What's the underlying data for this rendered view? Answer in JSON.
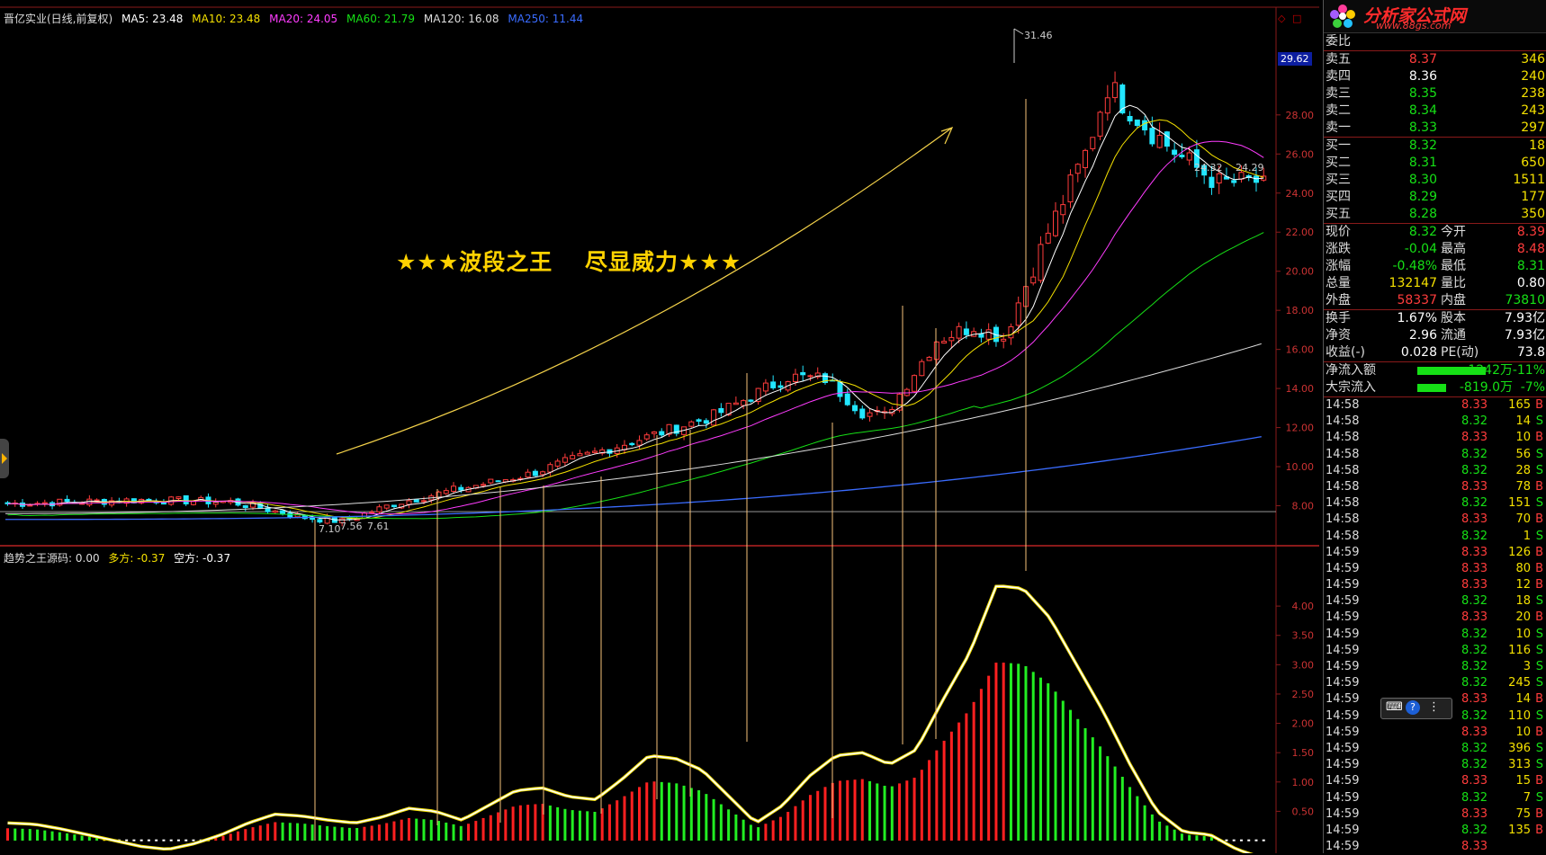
{
  "header": {
    "title": "晋亿实业(日线,前复权)",
    "ma5": "MA5: 23.48",
    "ma10": "MA10: 23.48",
    "ma20": "MA20: 24.05",
    "ma60": "MA60: 21.79",
    "ma120": "MA120: 16.08",
    "ma250": "MA250: 11.44",
    "colors": {
      "ma5": "#ffffff",
      "ma10": "#f4e000",
      "ma20": "#ff3cff",
      "ma60": "#16e016",
      "ma120": "#dddddd",
      "ma250": "#3a6cff"
    }
  },
  "main_chart": {
    "slogan": "★★★波段之王　 尽显威力★★★",
    "price_axis": [
      "28.00",
      "26.00",
      "24.00",
      "22.00",
      "20.00",
      "18.00",
      "16.00",
      "14.00",
      "12.00",
      "10.00",
      "8.00"
    ],
    "current_price_tag": "29.62",
    "high_label": "31.46",
    "low_label": "7.10",
    "label_756": "7.56",
    "label_761": "7.61",
    "label_2432": "24.32",
    "label_2429": "24.29"
  },
  "indicator": {
    "name": "趋势之王源码",
    "value": ": 0.00",
    "duofang": "多方: -0.37",
    "kongfang": "空方: -0.37",
    "axis": [
      "4.00",
      "3.50",
      "3.00",
      "2.50",
      "2.00",
      "1.50",
      "1.00",
      "0.50"
    ]
  },
  "chart_data": {
    "type": "line",
    "title": "",
    "price_ylim": [
      7,
      32
    ],
    "indicator_ylim": [
      -0.3,
      4.5
    ],
    "indicator_curve": [
      0.3,
      0.28,
      0.2,
      0.1,
      0.0,
      -0.1,
      -0.15,
      -0.05,
      0.1,
      0.3,
      0.45,
      0.42,
      0.35,
      0.3,
      0.4,
      0.55,
      0.5,
      0.35,
      0.6,
      0.85,
      0.9,
      0.75,
      0.7,
      1.05,
      1.45,
      1.4,
      1.2,
      0.75,
      0.3,
      0.6,
      1.1,
      1.45,
      1.5,
      1.3,
      1.55,
      2.4,
      3.2,
      4.35,
      4.3,
      3.8,
      3.0,
      2.2,
      1.3,
      0.5,
      0.15,
      0.1,
      -0.15,
      -0.3
    ]
  },
  "quote_panel": {
    "logo_title": "分析家公式网",
    "logo_url": "www.88gs.com",
    "weibi_label": "委比",
    "asks": [
      {
        "label": "卖五",
        "price": "8.37",
        "vol": "346"
      },
      {
        "label": "卖四",
        "price": "8.36",
        "vol": "240"
      },
      {
        "label": "卖三",
        "price": "8.35",
        "vol": "238"
      },
      {
        "label": "卖二",
        "price": "8.34",
        "vol": "243"
      },
      {
        "label": "卖一",
        "price": "8.33",
        "vol": "297"
      }
    ],
    "bids": [
      {
        "label": "买一",
        "price": "8.32",
        "vol": "18"
      },
      {
        "label": "买二",
        "price": "8.31",
        "vol": "650"
      },
      {
        "label": "买三",
        "price": "8.30",
        "vol": "1511"
      },
      {
        "label": "买四",
        "price": "8.29",
        "vol": "177"
      },
      {
        "label": "买五",
        "price": "8.28",
        "vol": "350"
      }
    ],
    "stats1": [
      {
        "l1": "现价",
        "v1": "8.32",
        "l2": "今开",
        "v2": "8.39"
      },
      {
        "l1": "涨跌",
        "v1": "-0.04",
        "l2": "最高",
        "v2": "8.48"
      },
      {
        "l1": "涨幅",
        "v1": "-0.48%",
        "l2": "最低",
        "v2": "8.31"
      },
      {
        "l1": "总量",
        "v1": "132147",
        "l2": "量比",
        "v2": "0.80"
      },
      {
        "l1": "外盘",
        "v1": "58337",
        "l2": "内盘",
        "v2": "73810"
      }
    ],
    "stats2": [
      {
        "l1": "换手",
        "v1": "1.67%",
        "l2": "股本",
        "v2": "7.93亿"
      },
      {
        "l1": "净资",
        "v1": "2.96",
        "l2": "流通",
        "v2": "7.93亿"
      },
      {
        "l1": "收益(-)",
        "v1": "0.028",
        "l2": "PE(动)",
        "v2": "73.8"
      }
    ],
    "flows": [
      {
        "label": "净流入额",
        "value": "-1242万",
        "pct": "-11%",
        "bar_fraction": 0.95
      },
      {
        "label": "大宗流入",
        "value": "-819.0万",
        "pct": "-7%",
        "bar_fraction": 0.4
      }
    ],
    "ticks": [
      {
        "t": "14:58",
        "p": "8.33",
        "v": "165",
        "d": "B"
      },
      {
        "t": "14:58",
        "p": "8.32",
        "v": "14",
        "d": "S"
      },
      {
        "t": "14:58",
        "p": "8.33",
        "v": "10",
        "d": "B"
      },
      {
        "t": "14:58",
        "p": "8.32",
        "v": "56",
        "d": "S"
      },
      {
        "t": "14:58",
        "p": "8.32",
        "v": "28",
        "d": "S"
      },
      {
        "t": "14:58",
        "p": "8.33",
        "v": "78",
        "d": "B"
      },
      {
        "t": "14:58",
        "p": "8.32",
        "v": "151",
        "d": "S"
      },
      {
        "t": "14:58",
        "p": "8.33",
        "v": "70",
        "d": "B"
      },
      {
        "t": "14:58",
        "p": "8.32",
        "v": "1",
        "d": "S"
      },
      {
        "t": "14:59",
        "p": "8.33",
        "v": "126",
        "d": "B"
      },
      {
        "t": "14:59",
        "p": "8.33",
        "v": "80",
        "d": "B"
      },
      {
        "t": "14:59",
        "p": "8.33",
        "v": "12",
        "d": "B"
      },
      {
        "t": "14:59",
        "p": "8.32",
        "v": "18",
        "d": "S"
      },
      {
        "t": "14:59",
        "p": "8.33",
        "v": "20",
        "d": "B"
      },
      {
        "t": "14:59",
        "p": "8.32",
        "v": "10",
        "d": "S"
      },
      {
        "t": "14:59",
        "p": "8.32",
        "v": "116",
        "d": "S"
      },
      {
        "t": "14:59",
        "p": "8.32",
        "v": "3",
        "d": "S"
      },
      {
        "t": "14:59",
        "p": "8.32",
        "v": "245",
        "d": "S"
      },
      {
        "t": "14:59",
        "p": "8.33",
        "v": "14",
        "d": "B"
      },
      {
        "t": "14:59",
        "p": "8.32",
        "v": "110",
        "d": "S"
      },
      {
        "t": "14:59",
        "p": "8.33",
        "v": "10",
        "d": "B"
      },
      {
        "t": "14:59",
        "p": "8.32",
        "v": "396",
        "d": "S"
      },
      {
        "t": "14:59",
        "p": "8.32",
        "v": "313",
        "d": "S"
      },
      {
        "t": "14:59",
        "p": "8.33",
        "v": "15",
        "d": "B"
      },
      {
        "t": "14:59",
        "p": "8.32",
        "v": "7",
        "d": "S"
      },
      {
        "t": "14:59",
        "p": "8.33",
        "v": "75",
        "d": "B"
      },
      {
        "t": "14:59",
        "p": "8.32",
        "v": "135",
        "d": "B"
      },
      {
        "t": "14:59",
        "p": "8.33",
        "v": "",
        "d": ""
      }
    ]
  }
}
